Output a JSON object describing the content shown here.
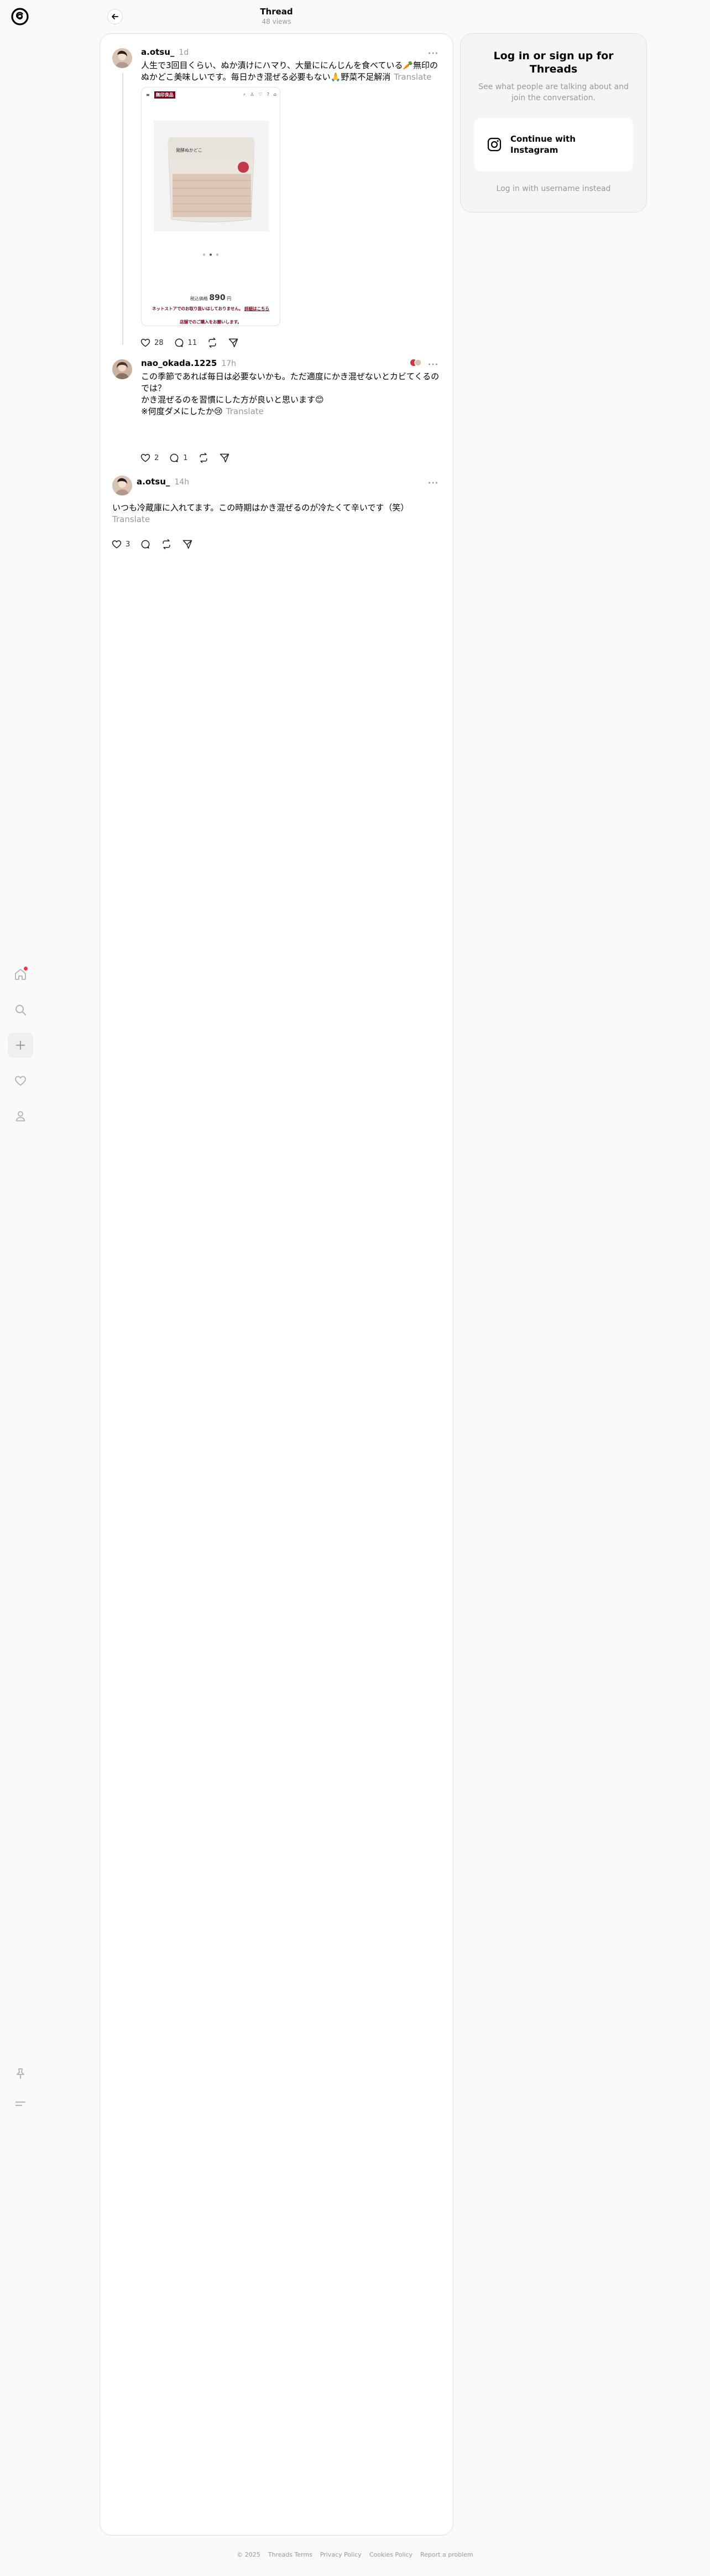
{
  "header": {
    "title": "Thread",
    "views": "48 views"
  },
  "posts": [
    {
      "username": "a.otsu_",
      "time": "1d",
      "text": "人生で3回目くらい、ぬか漬けにハマり、大量ににんじんを食べている🥕無印のぬかどこ美味しいです。毎日かき混ぜる必要もない🙏野菜不足解消",
      "translate": "Translate",
      "likes": "28",
      "replies": "11",
      "image": {
        "shop_name": "無印良品",
        "product_label": "発酵ぬかどこ",
        "price_label": "税込価格",
        "price": "890",
        "price_unit": "円",
        "net_note": "ネットストアでのお取り扱いはしておりません。",
        "net_link": "詳細はこちら",
        "store_note": "店舗でのご購入をお願いします。"
      }
    },
    {
      "username": "nao_okada.1225",
      "time": "17h",
      "text": "この季節であれば毎日は必要ないかも。ただ適度にかき混ぜないとカビてくるのでは？\nかき混ぜるのを習慣にした方が良いと思います😊\n※何度ダメにしたか😢",
      "translate": "Translate",
      "likes": "2",
      "replies": "1"
    },
    {
      "username": "a.otsu_",
      "time": "14h",
      "text": "いつも冷蔵庫に入れてます。この時期はかき混ぜるのが冷たくて辛いです（笑）",
      "translate": "Translate",
      "likes": "3",
      "replies": ""
    }
  ],
  "login": {
    "title": "Log in or sign up for Threads",
    "subtitle": "See what people are talking about and join the conversation.",
    "instagram_button": "Continue with Instagram",
    "username_link": "Log in with username instead"
  },
  "footer": {
    "copyright": "© 2025",
    "links": [
      "Threads Terms",
      "Privacy Policy",
      "Cookies Policy",
      "Report a problem"
    ]
  },
  "colors": {
    "notification_dot": "#ff3040",
    "muji_red": "#7f0019"
  },
  "icons": {
    "rail": [
      "home-icon",
      "search-icon",
      "create-icon",
      "heart-icon",
      "profile-icon",
      "pin-icon",
      "menu-icon"
    ]
  }
}
